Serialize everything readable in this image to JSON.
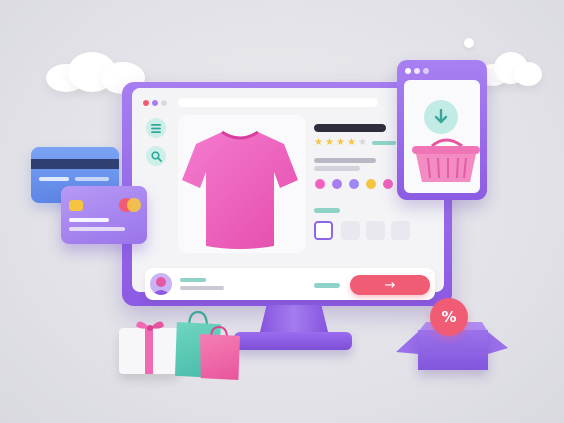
{
  "colors": {
    "accent_purple": "#8c5ae3",
    "accent_pink": "#ef5c74",
    "accent_teal": "#47bba7",
    "shirt_pink": "#f062bd",
    "card_blue": "#6a92ee"
  },
  "icons": {
    "menu": "menu-icon",
    "search": "search-icon",
    "arrow_right": "arrow-right-icon",
    "download": "download-icon",
    "basket": "basket-icon",
    "percent": "percent-icon"
  },
  "product": {
    "rating_stars_filled": 4,
    "rating_stars_total": 5,
    "color_options": [
      "#f062bd",
      "#a77ef0",
      "#9f86f0",
      "#f5c542",
      "#f062bd"
    ],
    "size_options_count": 4,
    "selected_size_index": 0
  },
  "cta": {
    "arrow": "→"
  },
  "discount": {
    "symbol": "%"
  }
}
